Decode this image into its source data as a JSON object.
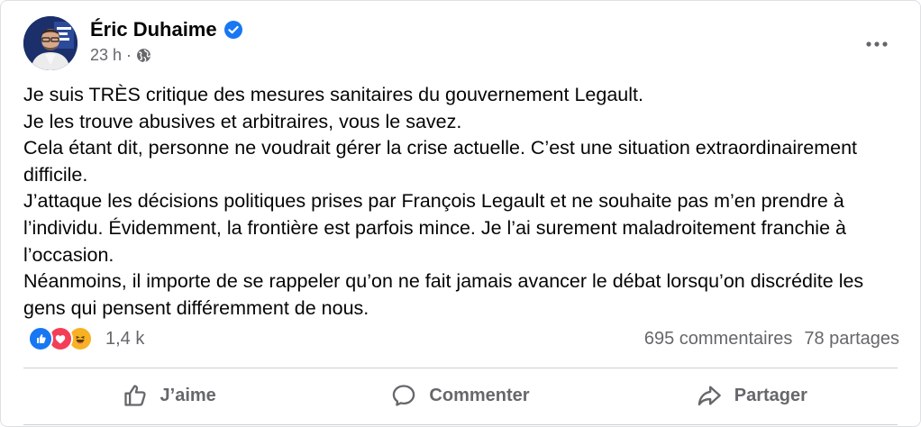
{
  "post": {
    "author": "Éric Duhaime",
    "timestamp": "23 h",
    "separator": "·",
    "paragraphs": [
      "Je suis TRÈS critique des mesures sanitaires du gouvernement Legault.",
      "Je les trouve abusives et arbitraires, vous le savez.",
      "Cela étant dit, personne ne voudrait gérer la crise actuelle. C’est une situation extraordinairement difficile.",
      "J’attaque les décisions politiques prises par François Legault et ne souhaite pas m’en prendre à l’individu. Évidemment, la frontière est parfois mince. Je l’ai surement maladroitement franchie à l’occasion.",
      "Néanmoins, il importe de se rappeler qu’on ne fait jamais avancer le débat lorsqu’on discrédite les gens qui pensent différemment de nous."
    ],
    "reactions": {
      "icons": [
        "like-icon",
        "love-icon",
        "haha-icon"
      ],
      "count": "1,4 k"
    },
    "comments": "695 commentaires",
    "shares": "78 partages",
    "actions": {
      "like": "J’aime",
      "comment": "Commenter",
      "share": "Partager"
    }
  },
  "colors": {
    "brand_blue": "#1877f2",
    "love_red": "#f33e58",
    "haha_yellow": "#f7b125",
    "secondary_text": "#65676b"
  }
}
